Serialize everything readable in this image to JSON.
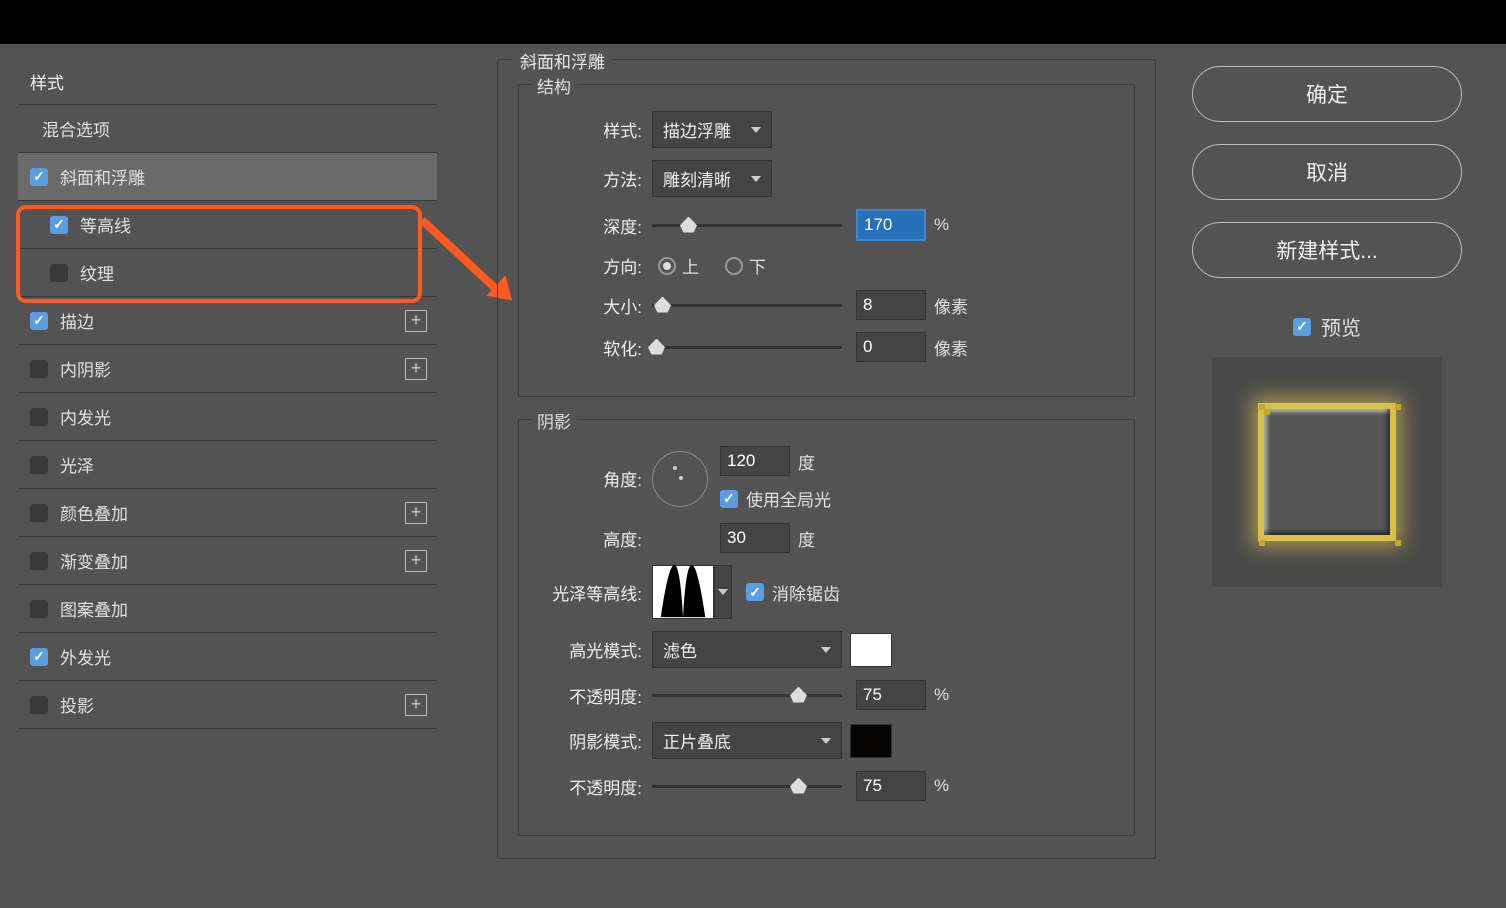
{
  "left": {
    "header": "样式",
    "items": [
      {
        "label": "混合选项",
        "checkbox": false,
        "checked": false,
        "plus": false,
        "selected": false,
        "sub": false
      },
      {
        "label": "斜面和浮雕",
        "checkbox": true,
        "checked": true,
        "plus": false,
        "selected": true,
        "sub": false
      },
      {
        "label": "等高线",
        "checkbox": true,
        "checked": true,
        "plus": false,
        "selected": false,
        "sub": true
      },
      {
        "label": "纹理",
        "checkbox": true,
        "checked": false,
        "plus": false,
        "selected": false,
        "sub": true
      },
      {
        "label": "描边",
        "checkbox": true,
        "checked": true,
        "plus": true,
        "selected": false,
        "sub": false
      },
      {
        "label": "内阴影",
        "checkbox": true,
        "checked": false,
        "plus": true,
        "selected": false,
        "sub": false
      },
      {
        "label": "内发光",
        "checkbox": true,
        "checked": false,
        "plus": false,
        "selected": false,
        "sub": false
      },
      {
        "label": "光泽",
        "checkbox": true,
        "checked": false,
        "plus": false,
        "selected": false,
        "sub": false
      },
      {
        "label": "颜色叠加",
        "checkbox": true,
        "checked": false,
        "plus": true,
        "selected": false,
        "sub": false
      },
      {
        "label": "渐变叠加",
        "checkbox": true,
        "checked": false,
        "plus": true,
        "selected": false,
        "sub": false
      },
      {
        "label": "图案叠加",
        "checkbox": true,
        "checked": false,
        "plus": false,
        "selected": false,
        "sub": false
      },
      {
        "label": "外发光",
        "checkbox": true,
        "checked": true,
        "plus": false,
        "selected": false,
        "sub": false
      },
      {
        "label": "投影",
        "checkbox": true,
        "checked": false,
        "plus": true,
        "selected": false,
        "sub": false
      }
    ]
  },
  "panel": {
    "title": "斜面和浮雕",
    "structure_legend": "结构",
    "style_label": "样式:",
    "style_value": "描边浮雕",
    "technique_label": "方法:",
    "technique_value": "雕刻清晰",
    "depth_label": "深度:",
    "depth_value": "170",
    "depth_unit": "%",
    "direction_label": "方向:",
    "direction_up": "上",
    "direction_down": "下",
    "direction_selected": "up",
    "size_label": "大小:",
    "size_value": "8",
    "size_unit": "像素",
    "soften_label": "软化:",
    "soften_value": "0",
    "soften_unit": "像素",
    "shading_legend": "阴影",
    "angle_label": "角度:",
    "angle_value": "120",
    "angle_unit": "度",
    "global_light_label": "使用全局光",
    "global_light_checked": true,
    "altitude_label": "高度:",
    "altitude_value": "30",
    "altitude_unit": "度",
    "gloss_contour_label": "光泽等高线:",
    "antialias_label": "消除锯齿",
    "antialias_checked": true,
    "highlight_mode_label": "高光模式:",
    "highlight_mode_value": "滤色",
    "highlight_color": "#ffffff",
    "highlight_opacity_label": "不透明度:",
    "highlight_opacity_value": "75",
    "highlight_opacity_unit": "%",
    "shadow_mode_label": "阴影模式:",
    "shadow_mode_value": "正片叠底",
    "shadow_color": "#050402",
    "shadow_opacity_label": "不透明度:",
    "shadow_opacity_value": "75",
    "shadow_opacity_unit": "%"
  },
  "right": {
    "ok": "确定",
    "cancel": "取消",
    "new_style": "新建样式...",
    "preview": "预览",
    "preview_checked": true
  }
}
